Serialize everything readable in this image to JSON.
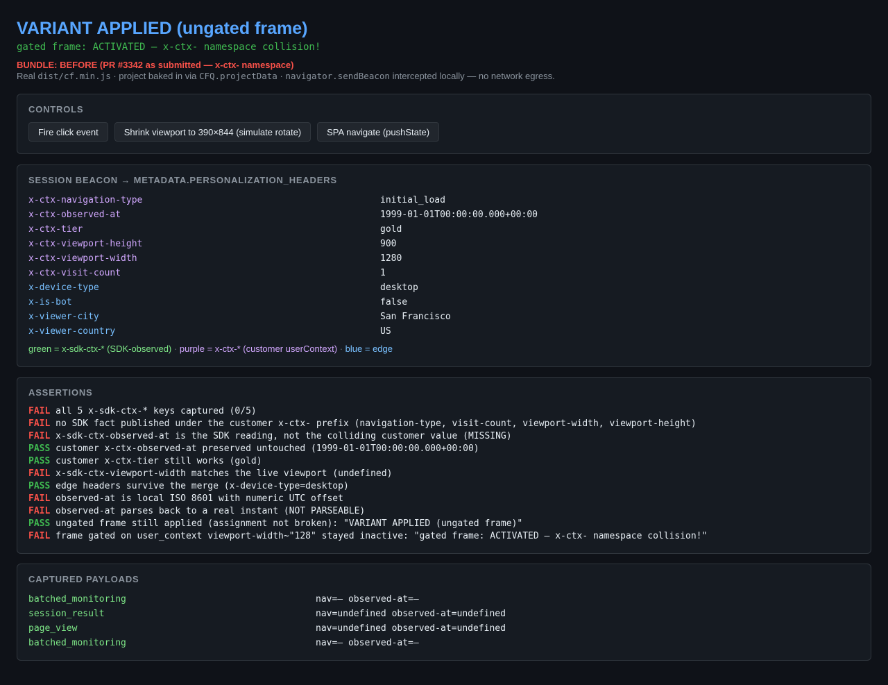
{
  "header": {
    "title": "VARIANT APPLIED (ungated frame)",
    "subtitle": "gated frame: ACTIVATED — x-ctx- namespace collision!",
    "bundle": "BUNDLE: BEFORE (PR #3342 as submitted — x-ctx- namespace)",
    "real_prefix": "Real",
    "real_file": "dist/cf.min.js",
    "real_mid1": "· project baked in via",
    "real_code2": "CFQ.projectData",
    "real_mid2": "·",
    "real_code3": "navigator.sendBeacon",
    "real_suffix": "intercepted locally — no network egress."
  },
  "controls": {
    "title": "CONTROLS",
    "buttons": [
      "Fire click event",
      "Shrink viewport to 390×844 (simulate rotate)",
      "SPA navigate (pushState)"
    ]
  },
  "beacon": {
    "title": "SESSION BEACON → METADATA.PERSONALIZATION_HEADERS",
    "rows": [
      {
        "key": "x-ctx-navigation-type",
        "value": "initial_load",
        "kind": "purple"
      },
      {
        "key": "x-ctx-observed-at",
        "value": "1999-01-01T00:00:00.000+00:00",
        "kind": "purple"
      },
      {
        "key": "x-ctx-tier",
        "value": "gold",
        "kind": "purple"
      },
      {
        "key": "x-ctx-viewport-height",
        "value": "900",
        "kind": "purple"
      },
      {
        "key": "x-ctx-viewport-width",
        "value": "1280",
        "kind": "purple"
      },
      {
        "key": "x-ctx-visit-count",
        "value": "1",
        "kind": "purple"
      },
      {
        "key": "x-device-type",
        "value": "desktop",
        "kind": "blue"
      },
      {
        "key": "x-is-bot",
        "value": "false",
        "kind": "blue"
      },
      {
        "key": "x-viewer-city",
        "value": "San Francisco",
        "kind": "blue"
      },
      {
        "key": "x-viewer-country",
        "value": "US",
        "kind": "blue"
      }
    ],
    "legend": {
      "green": "green = x-sdk-ctx-* (SDK-observed)",
      "purple": "purple = x-ctx-* (customer userContext)",
      "blue": "blue = edge",
      "sep": "·"
    }
  },
  "assertions": {
    "title": "ASSERTIONS",
    "rows": [
      {
        "status": "FAIL",
        "text": "all 5 x-sdk-ctx-* keys captured (0/5)"
      },
      {
        "status": "FAIL",
        "text": "no SDK fact published under the customer x-ctx- prefix (navigation-type, visit-count, viewport-width, viewport-height)"
      },
      {
        "status": "FAIL",
        "text": "x-sdk-ctx-observed-at is the SDK reading, not the colliding customer value (MISSING)"
      },
      {
        "status": "PASS",
        "text": "customer x-ctx-observed-at preserved untouched (1999-01-01T00:00:00.000+00:00)"
      },
      {
        "status": "PASS",
        "text": "customer x-ctx-tier still works (gold)"
      },
      {
        "status": "FAIL",
        "text": "x-sdk-ctx-viewport-width matches the live viewport (undefined)"
      },
      {
        "status": "PASS",
        "text": "edge headers survive the merge (x-device-type=desktop)"
      },
      {
        "status": "FAIL",
        "text": "observed-at is local ISO 8601 with numeric UTC offset"
      },
      {
        "status": "FAIL",
        "text": "observed-at parses back to a real instant (NOT PARSEABLE)"
      },
      {
        "status": "PASS",
        "text": "ungated frame still applied (assignment not broken): \"VARIANT APPLIED (ungated frame)\""
      },
      {
        "status": "FAIL",
        "text": "frame gated on user_context viewport-width~\"128\" stayed inactive: \"gated frame: ACTIVATED — x-ctx- namespace collision!\""
      }
    ]
  },
  "payloads": {
    "title": "CAPTURED PAYLOADS",
    "rows": [
      {
        "name": "batched_monitoring",
        "value": "nav=— observed-at=—"
      },
      {
        "name": "session_result",
        "value": "nav=undefined observed-at=undefined"
      },
      {
        "name": "page_view",
        "value": "nav=undefined observed-at=undefined"
      },
      {
        "name": "batched_monitoring",
        "value": "nav=— observed-at=—"
      }
    ]
  },
  "colors": {
    "background": "#0f1218",
    "panel": "#161b22",
    "title_blue": "#58a6ff",
    "pass_green": "#3fb950",
    "fail_red": "#f85149",
    "customer_purple": "#d2a8ff",
    "edge_blue": "#79c0ff",
    "sdk_green": "#7ee787"
  }
}
